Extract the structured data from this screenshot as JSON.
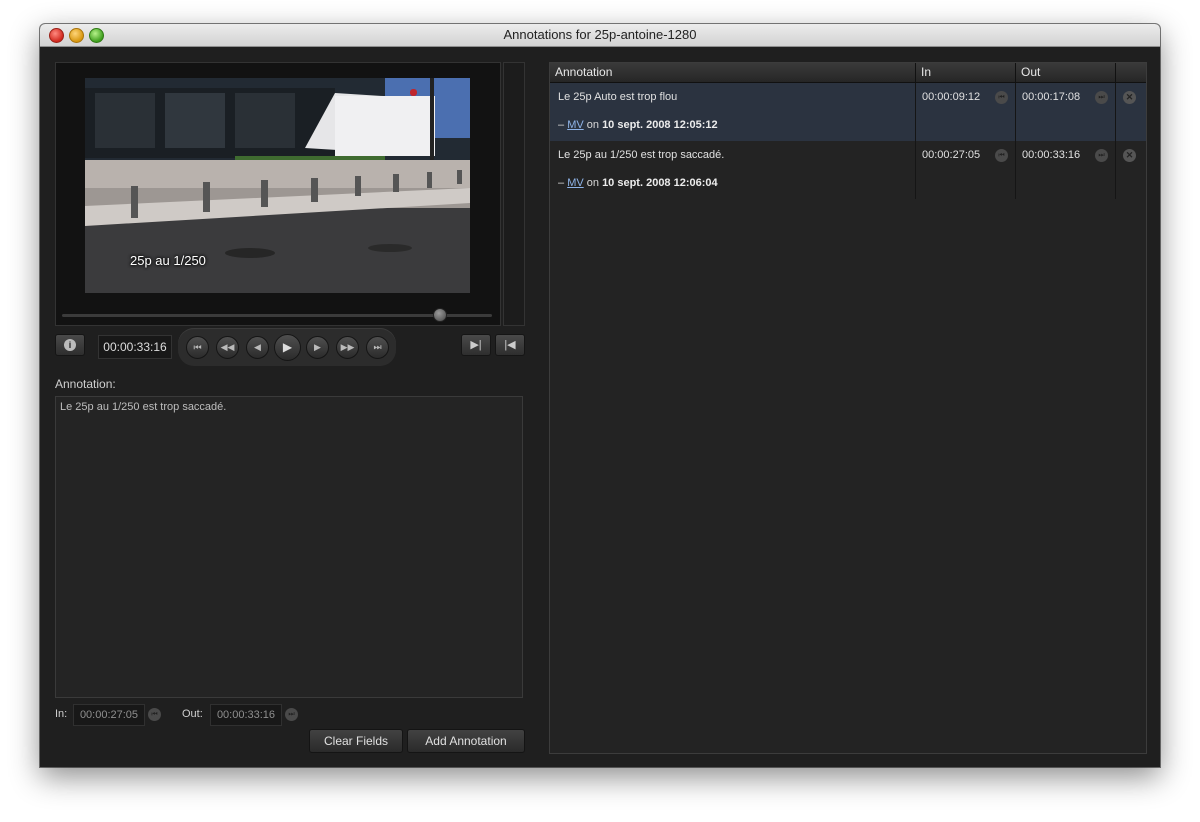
{
  "window": {
    "title": "Annotations for 25p-antoine-1280"
  },
  "player": {
    "caption": "25p au 1/250",
    "watermark": "",
    "timecode": "00:00:33:16",
    "info_label": "i",
    "playhead_fraction": 0.88,
    "transport_glyphs": {
      "start": "⏮",
      "rewind": "◀◀",
      "step_back": "◀",
      "play": "▶",
      "step_forward": "▶",
      "fast_forward": "▶▶",
      "end": "⏭"
    },
    "mark_in_glyph": "▶|",
    "mark_out_glyph": "|◀"
  },
  "form": {
    "annotation_label": "Annotation:",
    "annotation_text": "Le 25p au 1/250 est trop saccadé.",
    "in_label": "In:",
    "in_value": "00:00:27:05",
    "out_label": "Out:",
    "out_value": "00:00:33:16",
    "clear_button": "Clear Fields",
    "add_button": "Add Annotation"
  },
  "table": {
    "headers": {
      "annotation": "Annotation",
      "in": "In",
      "out": "Out"
    },
    "rows": [
      {
        "text": "Le 25p Auto est trop flou",
        "dash": "–",
        "author": "MV",
        "on": "on",
        "date": "10 sept. 2008 12:05:12",
        "in": "00:00:09:12",
        "out": "00:00:17:08",
        "selected": true
      },
      {
        "text": "Le 25p au 1/250 est trop saccadé.",
        "dash": "–",
        "author": "MV",
        "on": "on",
        "date": "10 sept. 2008 12:06:04",
        "in": "00:00:27:05",
        "out": "00:00:33:16",
        "selected": false
      }
    ]
  },
  "icons": {
    "jump_in": "jump-to-in-icon",
    "jump_out": "jump-to-out-icon",
    "delete": "delete-icon"
  },
  "colors": {
    "window_bg": "#1f1f1f",
    "selected_row": "#2b3340",
    "link": "#8fb4e8"
  }
}
